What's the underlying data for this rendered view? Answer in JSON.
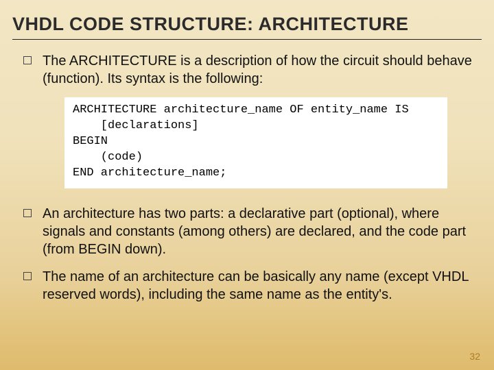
{
  "title": "VHDL CODE STRUCTURE: ARCHITECTURE",
  "bullets": [
    "The ARCHITECTURE is a description of how the circuit should behave (function). Its syntax is the following:",
    "An architecture has two parts: a declarative part (optional), where signals and constants (among others) are declared, and the code part (from BEGIN down).",
    "The name of an architecture can be basically any name (except VHDL reserved words), including the same name as the entity's."
  ],
  "code": "ARCHITECTURE architecture_name OF entity_name IS\n    [declarations]\nBEGIN\n    (code)\nEND architecture_name;",
  "page_number": "32"
}
